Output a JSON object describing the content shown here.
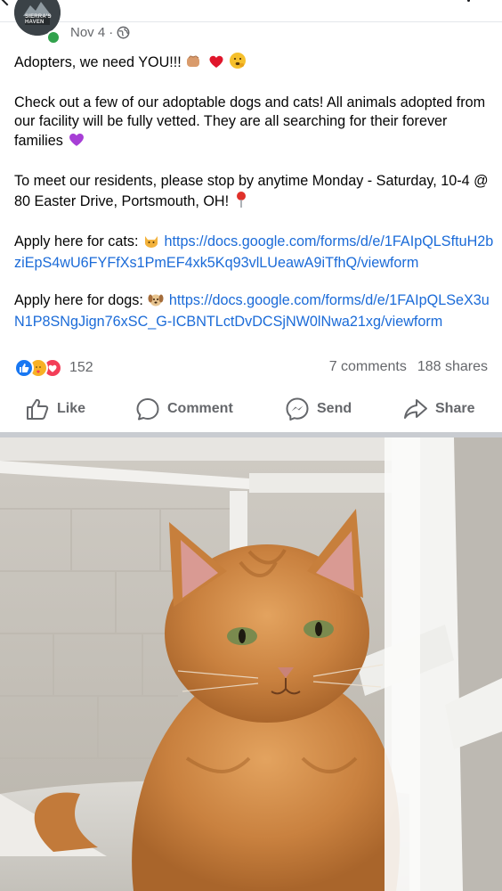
{
  "post": {
    "date": "Nov 4",
    "dot": "·",
    "avatar_text": "SIERRA'S HAVEN",
    "line_intro": "Adopters, we need YOU!!!",
    "line_check": "Check out a few of our adoptable dogs and cats! All animals adopted from our facility will be fully vetted. They are all searching for their forever families",
    "line_visit": "To meet our residents, please stop by anytime Monday - Saturday, 10-4 @ 80 Easter Drive, Portsmouth, OH!",
    "cats_label": "Apply here for cats:",
    "cats_link": "https://docs.google.com/forms/d/e/1FAIpQLSftuH2bziEpS4wU6FYFfXs1PmEF4xk5Kq93vlLUeawA9iTfhQ/viewform",
    "dogs_label": "Apply here for dogs:",
    "dogs_link": "https://docs.google.com/forms/d/e/1FAIpQLSeX3uN1P8SNgJign76xSC_G-ICBNTLctDvDCSjNW0lNwa21xg/viewform"
  },
  "stats": {
    "reactions": "152",
    "comments": "7 comments",
    "shares": "188 shares"
  },
  "actions": {
    "like": "Like",
    "comment": "Comment",
    "send": "Send",
    "share": "Share"
  },
  "colors": {
    "link": "#1b6bd8",
    "secondary_text": "#65676b",
    "online": "#31a24c",
    "like_blue": "#1877f2",
    "love_red": "#f33e58"
  },
  "icons": [
    "globe-icon",
    "like-icon",
    "comment-icon",
    "send-icon",
    "share-icon"
  ]
}
